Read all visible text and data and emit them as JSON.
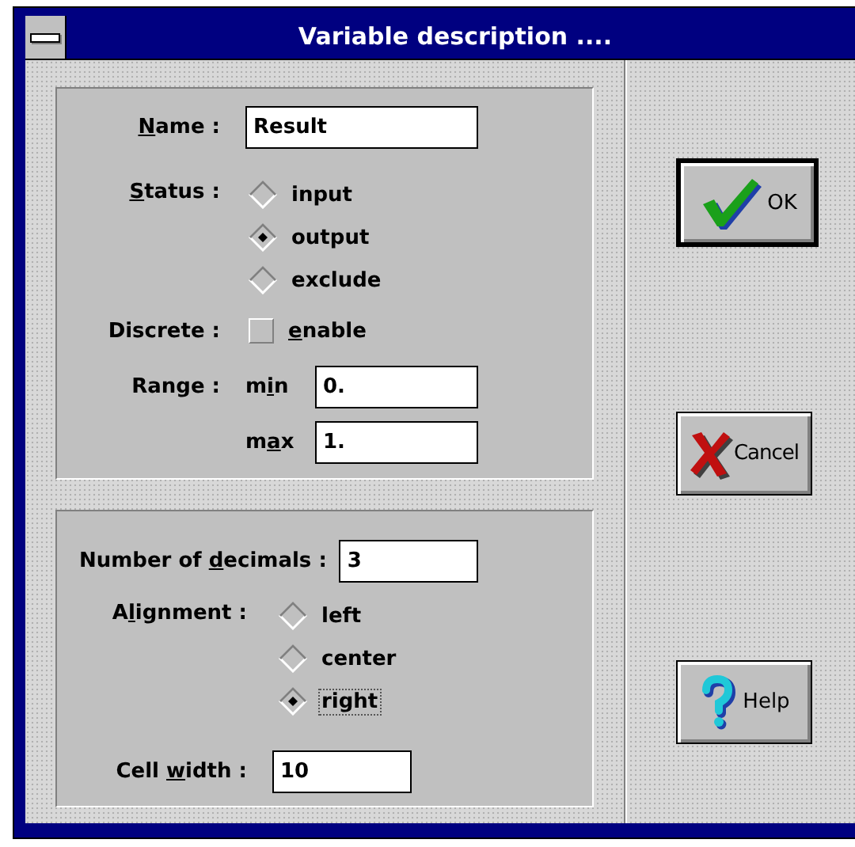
{
  "window": {
    "title": "Variable description ...."
  },
  "variable": {
    "name": {
      "label": {
        "key": "N",
        "post": "ame :"
      },
      "value": "Result"
    },
    "status": {
      "label": {
        "key": "S",
        "post": "tatus :"
      },
      "options": [
        {
          "label": "input",
          "selected": false
        },
        {
          "label": "output",
          "selected": true
        },
        {
          "label": "exclude",
          "selected": false
        }
      ]
    },
    "discrete": {
      "label": {
        "pre": "Discrete :"
      },
      "checkbox": {
        "label": {
          "key": "e",
          "post": "nable"
        },
        "checked": false
      }
    },
    "range": {
      "label": {
        "pre": "Range :"
      },
      "min": {
        "label": {
          "pre": "m",
          "key": "i",
          "post": "n"
        },
        "value": "0."
      },
      "max": {
        "label": {
          "pre": "m",
          "key": "a",
          "post": "x"
        },
        "value": "1."
      }
    }
  },
  "format": {
    "decimals": {
      "label": {
        "pre": "Number of ",
        "key": "d",
        "post": "ecimals :"
      },
      "value": "3"
    },
    "alignment": {
      "label": {
        "pre": "A",
        "key": "l",
        "post": "ignment :"
      },
      "options": [
        {
          "label": "left",
          "selected": false,
          "focused": false
        },
        {
          "label": "center",
          "selected": false,
          "focused": false
        },
        {
          "label": "right",
          "selected": true,
          "focused": true
        }
      ]
    },
    "cell_width": {
      "label": {
        "pre": "Cell ",
        "key": "w",
        "post": "idth :"
      },
      "value": "10"
    }
  },
  "buttons": [
    {
      "kind": "ok",
      "label": "OK",
      "default": true
    },
    {
      "kind": "cancel",
      "label": "Cancel",
      "default": false
    },
    {
      "kind": "help",
      "label": "Help",
      "default": false
    }
  ]
}
